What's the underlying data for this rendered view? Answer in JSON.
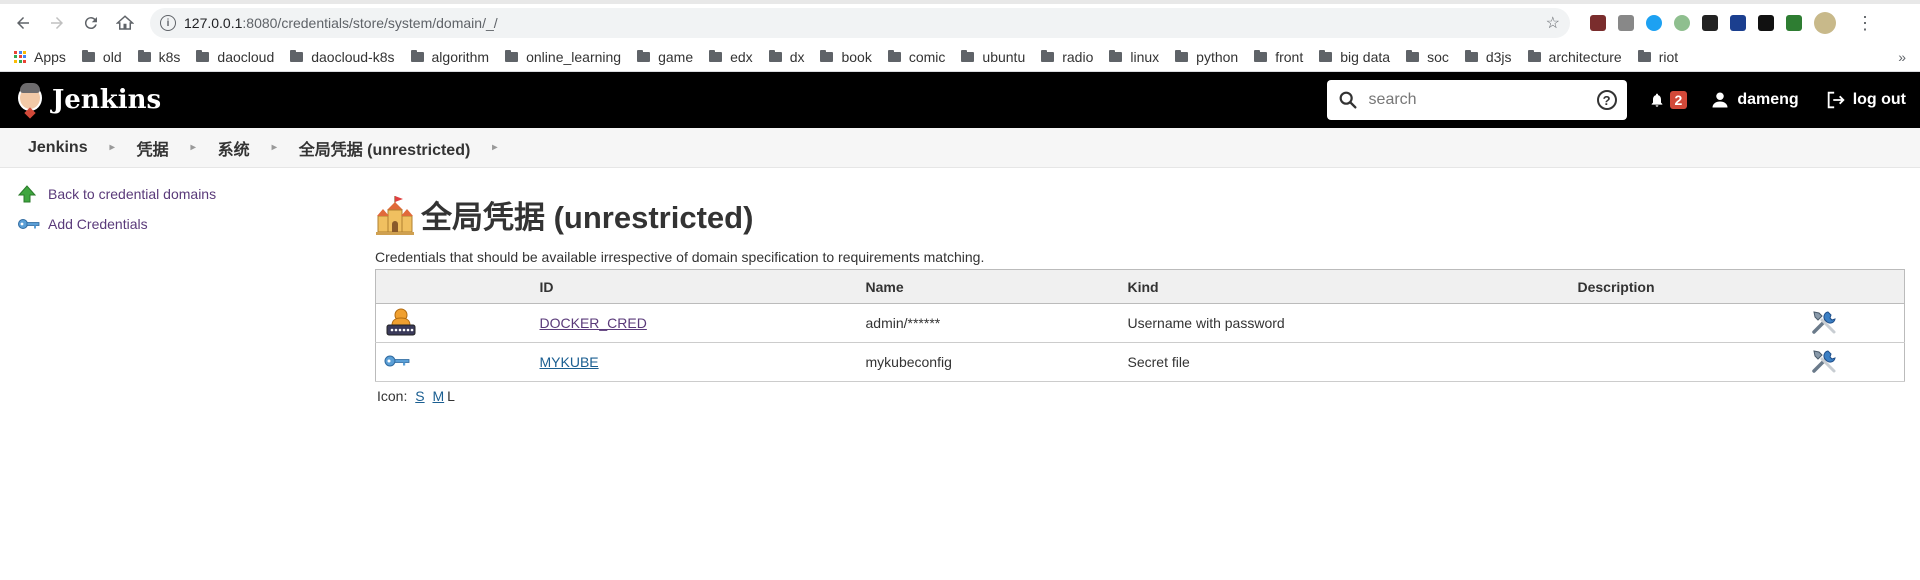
{
  "browser": {
    "url_host": "127.0.0.1",
    "url_path": ":8080/credentials/store/system/domain/_/"
  },
  "bookmarks": {
    "apps_label": "Apps",
    "items": [
      "old",
      "k8s",
      "daocloud",
      "daocloud-k8s",
      "algorithm",
      "online_learning",
      "game",
      "edx",
      "dx",
      "book",
      "comic",
      "ubuntu",
      "radio",
      "linux",
      "python",
      "front",
      "big data",
      "soc",
      "d3js",
      "architecture",
      "riot"
    ],
    "more": "»"
  },
  "header": {
    "logo_text": "Jenkins",
    "search_placeholder": "search",
    "help_label": "?",
    "notification_count": "2",
    "username": "dameng",
    "logout_label": "log out"
  },
  "breadcrumb": [
    "Jenkins",
    "凭据",
    "系统",
    "全局凭据 (unrestricted)"
  ],
  "sidebar": {
    "back_label": "Back to credential domains",
    "add_label": "Add Credentials"
  },
  "main": {
    "title": "全局凭据 (unrestricted)",
    "description": "Credentials that should be available irrespective of domain specification to requirements matching.",
    "columns": [
      "ID",
      "Name",
      "Kind",
      "Description"
    ],
    "rows": [
      {
        "id": "DOCKER_CRED",
        "name": "admin/******",
        "kind": "Username with password",
        "description": ""
      },
      {
        "id": "MYKUBE",
        "name": "mykubeconfig",
        "kind": "Secret file",
        "description": ""
      }
    ],
    "icon_size_label": "Icon:",
    "icon_sizes": [
      "S",
      "M",
      "L"
    ]
  },
  "colors": {
    "header_bg": "#000000",
    "badge": "#d24939",
    "link_visited": "#5a3a7a",
    "link": "#1a5e91"
  }
}
